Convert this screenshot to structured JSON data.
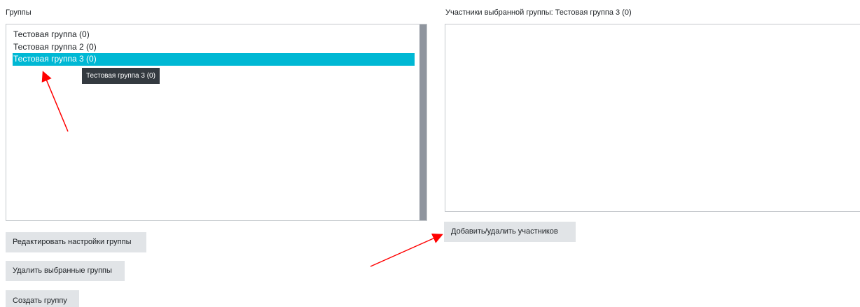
{
  "groups_label": "Группы",
  "members_label": "Участники выбранной группы: Тестовая группа 3 (0)",
  "groups": [
    {
      "label": "Тестовая группа (0)",
      "selected": false
    },
    {
      "label": "Тестовая группа 2 (0)",
      "selected": false
    },
    {
      "label": "Тестовая группа 3 (0)",
      "selected": true
    }
  ],
  "tooltip": "Тестовая группа 3 (0)",
  "buttons": {
    "edit_group": "Редактировать настройки группы",
    "add_remove_members": "Добавить/удалить участников",
    "delete_groups": "Удалить выбранные группы",
    "create_group": "Создать группу"
  },
  "colors": {
    "selection": "#00b8d4",
    "button_bg": "#e1e4e7",
    "tooltip_bg": "#343a40",
    "annotation_arrow": "#ff0000"
  }
}
